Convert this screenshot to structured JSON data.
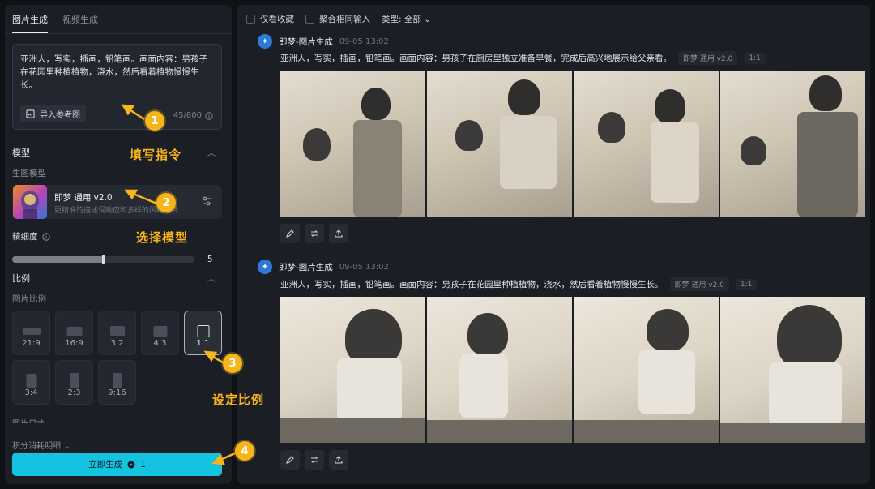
{
  "tabs": [
    "图片生成",
    "视频生成"
  ],
  "prompt": {
    "text": "亚洲人，写实，插画，铅笔画。画面内容：男孩子在花园里种植植物，浇水，然后看着植物慢慢生长。",
    "ref_button": "导入参考图",
    "counter": "45/800"
  },
  "model_section": {
    "title": "模型",
    "sub": "生图模型",
    "model_name": "即梦 通用 v2.0",
    "model_desc": "更精准的描述词响应和多样的风格组合"
  },
  "detail": {
    "label": "精细度",
    "value": "5",
    "level": 0.5
  },
  "ratio_section": {
    "title": "比例",
    "sub": "图片比例",
    "options": [
      "21:9",
      "16:9",
      "3:2",
      "4:3",
      "1:1",
      "3:4",
      "2:3",
      "9:16"
    ],
    "selected": "1:1"
  },
  "size_label": "图片尺寸",
  "credits": "积分消耗明细",
  "generate": {
    "label": "立即生成",
    "cost": "1"
  },
  "annotations": [
    {
      "num": "1",
      "text": "填写指令"
    },
    {
      "num": "2",
      "text": "选择模型"
    },
    {
      "num": "3",
      "text": "设定比例"
    },
    {
      "num": "4",
      "text": ""
    }
  ],
  "filters": {
    "favorites": "仅看收藏",
    "merge": "聚合相同输入",
    "type": "类型: 全部"
  },
  "entries": [
    {
      "title": "即梦-图片生成",
      "date": "09-05",
      "time": "13:02",
      "prompt": "亚洲人，写实，插画，铅笔画。画面内容：男孩子在厨房里独立准备早餐，完成后高兴地展示给父亲看。",
      "model_tag": "即梦 通用 v2.0",
      "ratio_tag": "1:1"
    },
    {
      "title": "即梦-图片生成",
      "date": "09-05",
      "time": "13:02",
      "prompt": "亚洲人，写实，插画，铅笔画。画面内容：男孩子在花园里种植植物，浇水，然后看着植物慢慢生长。",
      "model_tag": "即梦 通用 v2.0",
      "ratio_tag": "1:1"
    }
  ],
  "colors": {
    "accent": "#14c3e0",
    "annotation": "#f6b51a",
    "panel": "#1b1e25"
  }
}
